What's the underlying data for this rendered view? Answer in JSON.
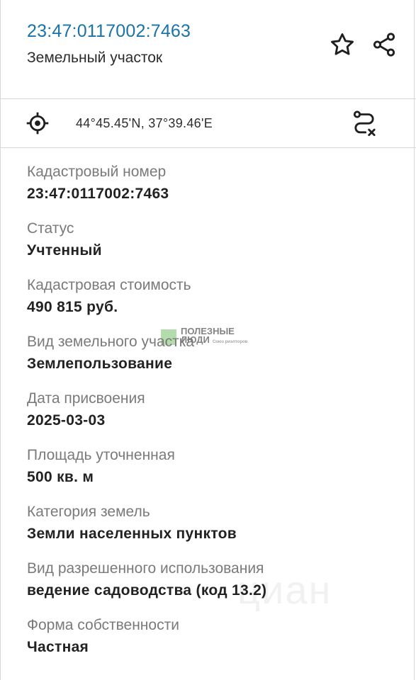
{
  "header": {
    "title": "23:47:0117002:7463",
    "subtitle": "Земельный участок"
  },
  "coords": {
    "text": "44°45.45'N, 37°39.46'E"
  },
  "fields": [
    {
      "label": "Кадастровый номер",
      "value": "23:47:0117002:7463"
    },
    {
      "label": "Статус",
      "value": "Учтенный"
    },
    {
      "label": "Кадастровая стоимость",
      "value": "490 815 руб."
    },
    {
      "label": "Вид земельного участка",
      "value": "Землепользование"
    },
    {
      "label": "Дата присвоения",
      "value": "2025-03-03"
    },
    {
      "label": "Площадь уточненная",
      "value": "500 кв. м"
    },
    {
      "label": "Категория земель",
      "value": "Земли населенных пунктов"
    },
    {
      "label": "Вид разрешенного использования",
      "value": "ведение садоводства (код 13.2)"
    },
    {
      "label": "Форма собственности",
      "value": "Частная"
    }
  ],
  "watermark": {
    "logo_line1": "ПОЛЕЗНЫЕ",
    "logo_line2": "ЛЮДИ",
    "logo_small": "Союз риэлторов",
    "cian": "циан"
  },
  "icons": {
    "star": "star-icon",
    "share": "share-icon",
    "target": "location-target-icon",
    "route": "route-icon"
  },
  "colors": {
    "title": "#1a73a8",
    "label": "#7a7a7a",
    "value": "#222222",
    "divider": "#d6d6d6"
  }
}
